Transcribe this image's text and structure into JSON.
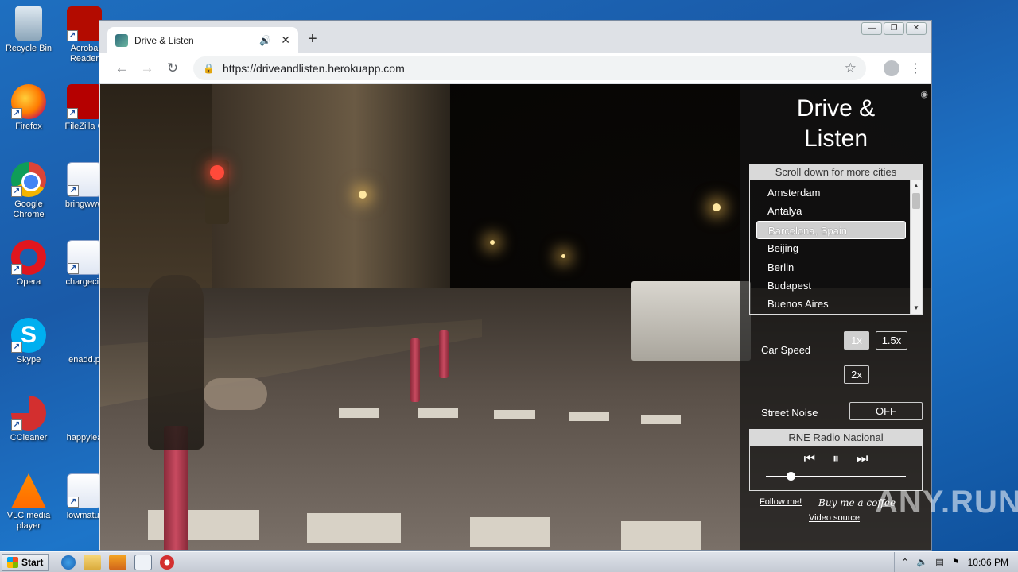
{
  "desktop": {
    "icons": [
      {
        "label": "Recycle Bin",
        "icon": "recycle-bin-icon"
      },
      {
        "label": "Acroba\nReader",
        "icon": "acrobat-icon"
      },
      {
        "label": "Firefox",
        "icon": "firefox-icon"
      },
      {
        "label": "FileZilla C",
        "icon": "filezilla-icon"
      },
      {
        "label": "Google Chrome",
        "icon": "chrome-icon"
      },
      {
        "label": "bringwww",
        "icon": "word-doc-icon"
      },
      {
        "label": "Opera",
        "icon": "opera-icon"
      },
      {
        "label": "chargeciv",
        "icon": "word-doc-icon"
      },
      {
        "label": "Skype",
        "icon": "skype-icon"
      },
      {
        "label": "enadd.p",
        "icon": "file-icon"
      },
      {
        "label": "CCleaner",
        "icon": "ccleaner-icon"
      },
      {
        "label": "happylea",
        "icon": "file-icon"
      },
      {
        "label": "VLC media player",
        "icon": "vlc-icon"
      },
      {
        "label": "lowmatur",
        "icon": "word-doc-icon"
      }
    ]
  },
  "browser": {
    "tab_title": "Drive & Listen",
    "url": "https://driveandlisten.herokuapp.com",
    "new_tab_symbol": "+",
    "close_symbol": "✕"
  },
  "panel": {
    "title_line1": "Drive &",
    "title_line2": "Listen",
    "cities_header": "Scroll down for more cities",
    "cities": [
      "Amsterdam",
      "Antalya",
      "Barcelona, Spain",
      "Beijing",
      "Berlin",
      "Budapest",
      "Buenos Aires"
    ],
    "selected_city": "Barcelona, Spain",
    "speed_label": "Car Speed",
    "speed_options": [
      "1x",
      "1.5x",
      "2x"
    ],
    "speed_selected": "1x",
    "noise_label": "Street Noise",
    "noise_value": "OFF",
    "radio_station": "RNE Radio Nacional",
    "volume_level": 0.15,
    "follow_link": "Follow me!",
    "coffee_text": "Buy me a coffee",
    "video_source_link": "Video source"
  },
  "watermark": "ANY.RUN",
  "taskbar": {
    "start_label": "Start",
    "time": "10:06 PM"
  }
}
